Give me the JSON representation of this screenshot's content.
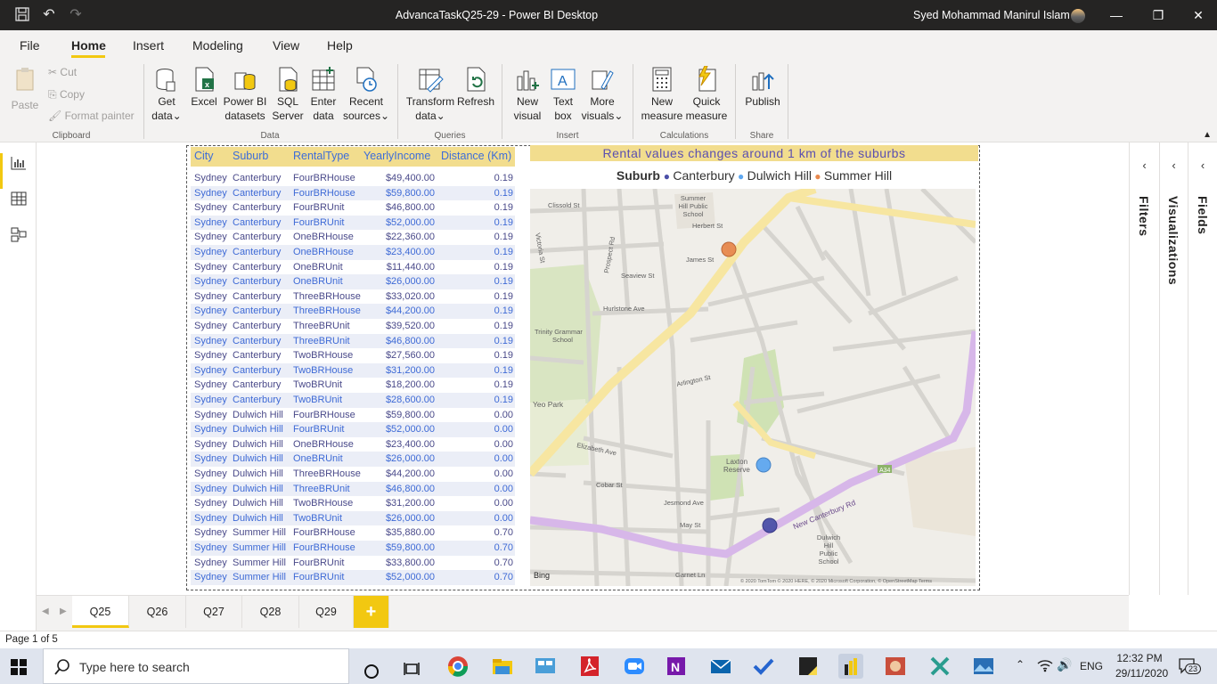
{
  "window": {
    "title": "AdvancaTaskQ25-29 - Power BI Desktop",
    "user": "Syed Mohammad Manirul Islam"
  },
  "menu": {
    "items": [
      "File",
      "Home",
      "Insert",
      "Modeling",
      "View",
      "Help"
    ],
    "active": "Home"
  },
  "ribbon": {
    "clipboard": {
      "paste": "Paste",
      "cut": "Cut",
      "copy": "Copy",
      "format_painter": "Format painter",
      "group": "Clipboard"
    },
    "data": {
      "get_data": [
        "Get",
        "data"
      ],
      "excel": "Excel",
      "powerbi": [
        "Power BI",
        "datasets"
      ],
      "sql": [
        "SQL",
        "Server"
      ],
      "enter": [
        "Enter",
        "data"
      ],
      "recent": [
        "Recent",
        "sources"
      ],
      "group": "Data"
    },
    "queries": {
      "transform": [
        "Transform",
        "data"
      ],
      "refresh": "Refresh",
      "group": "Queries"
    },
    "insert": {
      "new_visual": [
        "New",
        "visual"
      ],
      "text_box": [
        "Text",
        "box"
      ],
      "more_visuals": [
        "More",
        "visuals"
      ],
      "group": "Insert"
    },
    "calculations": {
      "new_measure": [
        "New",
        "measure"
      ],
      "quick_measure": [
        "Quick",
        "measure"
      ],
      "group": "Calculations"
    },
    "share": {
      "publish": "Publish",
      "group": "Share"
    }
  },
  "table": {
    "columns": [
      "City",
      "Suburb",
      "RentalType",
      "YearlyIncome",
      "Distance (Km)"
    ],
    "rows": [
      [
        "Sydney",
        "Canterbury",
        "FourBRHouse",
        "$49,400.00",
        "0.19"
      ],
      [
        "Sydney",
        "Canterbury",
        "FourBRHouse",
        "$59,800.00",
        "0.19"
      ],
      [
        "Sydney",
        "Canterbury",
        "FourBRUnit",
        "$46,800.00",
        "0.19"
      ],
      [
        "Sydney",
        "Canterbury",
        "FourBRUnit",
        "$52,000.00",
        "0.19"
      ],
      [
        "Sydney",
        "Canterbury",
        "OneBRHouse",
        "$22,360.00",
        "0.19"
      ],
      [
        "Sydney",
        "Canterbury",
        "OneBRHouse",
        "$23,400.00",
        "0.19"
      ],
      [
        "Sydney",
        "Canterbury",
        "OneBRUnit",
        "$11,440.00",
        "0.19"
      ],
      [
        "Sydney",
        "Canterbury",
        "OneBRUnit",
        "$26,000.00",
        "0.19"
      ],
      [
        "Sydney",
        "Canterbury",
        "ThreeBRHouse",
        "$33,020.00",
        "0.19"
      ],
      [
        "Sydney",
        "Canterbury",
        "ThreeBRHouse",
        "$44,200.00",
        "0.19"
      ],
      [
        "Sydney",
        "Canterbury",
        "ThreeBRUnit",
        "$39,520.00",
        "0.19"
      ],
      [
        "Sydney",
        "Canterbury",
        "ThreeBRUnit",
        "$46,800.00",
        "0.19"
      ],
      [
        "Sydney",
        "Canterbury",
        "TwoBRHouse",
        "$27,560.00",
        "0.19"
      ],
      [
        "Sydney",
        "Canterbury",
        "TwoBRHouse",
        "$31,200.00",
        "0.19"
      ],
      [
        "Sydney",
        "Canterbury",
        "TwoBRUnit",
        "$18,200.00",
        "0.19"
      ],
      [
        "Sydney",
        "Canterbury",
        "TwoBRUnit",
        "$28,600.00",
        "0.19"
      ],
      [
        "Sydney",
        "Dulwich Hill",
        "FourBRHouse",
        "$59,800.00",
        "0.00"
      ],
      [
        "Sydney",
        "Dulwich Hill",
        "FourBRUnit",
        "$52,000.00",
        "0.00"
      ],
      [
        "Sydney",
        "Dulwich Hill",
        "OneBRHouse",
        "$23,400.00",
        "0.00"
      ],
      [
        "Sydney",
        "Dulwich Hill",
        "OneBRUnit",
        "$26,000.00",
        "0.00"
      ],
      [
        "Sydney",
        "Dulwich Hill",
        "ThreeBRHouse",
        "$44,200.00",
        "0.00"
      ],
      [
        "Sydney",
        "Dulwich Hill",
        "ThreeBRUnit",
        "$46,800.00",
        "0.00"
      ],
      [
        "Sydney",
        "Dulwich Hill",
        "TwoBRHouse",
        "$31,200.00",
        "0.00"
      ],
      [
        "Sydney",
        "Dulwich Hill",
        "TwoBRUnit",
        "$26,000.00",
        "0.00"
      ],
      [
        "Sydney",
        "Summer Hill",
        "FourBRHouse",
        "$35,880.00",
        "0.70"
      ],
      [
        "Sydney",
        "Summer Hill",
        "FourBRHouse",
        "$59,800.00",
        "0.70"
      ],
      [
        "Sydney",
        "Summer Hill",
        "FourBRUnit",
        "$33,800.00",
        "0.70"
      ],
      [
        "Sydney",
        "Summer Hill",
        "FourBRUnit",
        "$52,000.00",
        "0.70"
      ]
    ]
  },
  "map": {
    "title": "Rental values changes around 1 km of the suburbs",
    "legend_title": "Suburb",
    "legend": [
      {
        "name": "Canterbury",
        "color": "#4b4fa8"
      },
      {
        "name": "Dulwich Hill",
        "color": "#5ea7f0"
      },
      {
        "name": "Summer Hill",
        "color": "#e8894e"
      }
    ],
    "bing": "Bing",
    "copyright": "© 2020 TomTom © 2020 HERE, © 2020 Microsoft Corporation, © OpenStreetMap Terms",
    "labels": {
      "summer_hill_school": [
        "Summer",
        "Hill Public",
        "School"
      ],
      "trinity": [
        "Trinity Grammar",
        "School"
      ],
      "yeo_park": "Yeo Park",
      "laxton": [
        "Laxton",
        "Reserve"
      ],
      "dulwich_school": [
        "Dulwich",
        "Hill",
        "Public",
        "School"
      ],
      "new_canterbury": "New Canterbury Rd",
      "hurlstone": "Hurlstone Ave",
      "prospect": "Prospect Rd",
      "arlington": "Arlington St",
      "elizabeth": "Elizabeth Ave",
      "cobar": "Cobar St",
      "jesmond": "Jesmond Ave",
      "may": "May St",
      "garnet": "Garnet Ln",
      "seaview": "Seaview St",
      "james": "James St",
      "herbert": "Herbert St",
      "clissold": "Clissold St",
      "victoria": "Victoria St",
      "a34": "A34"
    }
  },
  "pages": {
    "tabs": [
      "Q25",
      "Q26",
      "Q27",
      "Q28",
      "Q29"
    ],
    "active": "Q25",
    "add": "+",
    "status": "Page 1 of 5"
  },
  "panels": {
    "filters": "Filters",
    "visualizations": "Visualizations",
    "fields": "Fields"
  },
  "taskbar": {
    "search_placeholder": "Type here to search",
    "lang": "ENG",
    "time": "12:32 PM",
    "date": "29/11/2020",
    "notifications": "23"
  }
}
